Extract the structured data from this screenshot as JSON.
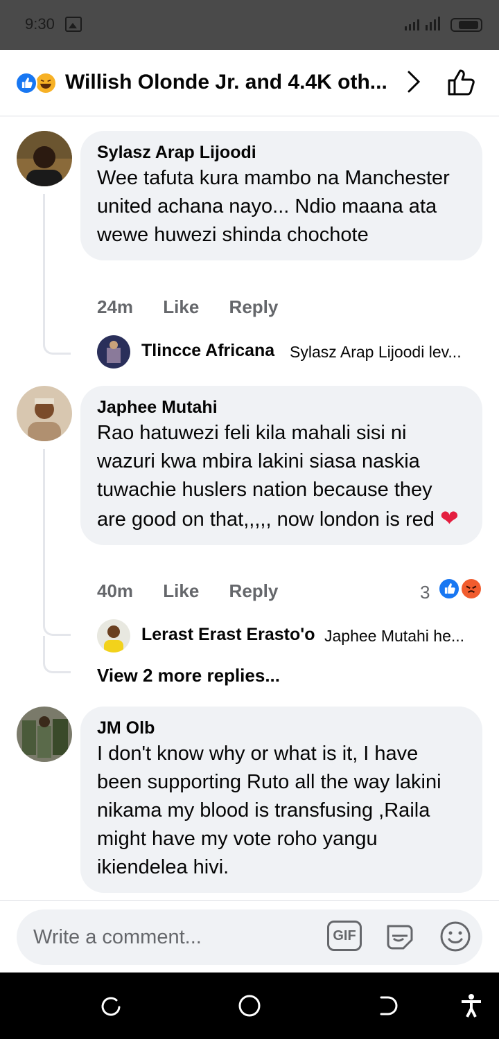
{
  "status_bar": {
    "time": "9:30"
  },
  "header": {
    "title": "Willish Olonde Jr. and 4.4K oth..."
  },
  "comments": [
    {
      "author": "Sylasz Arap Lijoodi",
      "text": "Wee tafuta kura mambo na Manchester united achana nayo... Ndio maana ata wewe huwezi shinda chochote",
      "time": "24m",
      "like_label": "Like",
      "reply_label": "Reply",
      "reply_preview": {
        "author": "Tlincce Africana",
        "snippet": "Sylasz Arap Lijoodi lev..."
      }
    },
    {
      "author": "Japhee Mutahi",
      "text": "Rao hatuwezi feli kila mahali sisi ni wazuri kwa mbira lakini siasa naskia tuwachie huslers nation because they are good on that,,,,, now london is red",
      "emoji": "❤",
      "time": "40m",
      "like_label": "Like",
      "reply_label": "Reply",
      "reaction_count": "3",
      "reactions": [
        "like-reaction",
        "angry-reaction"
      ],
      "reply_preview": {
        "author": "Lerast Erast Erasto'o",
        "snippet": "Japhee Mutahi he..."
      },
      "view_more": "View 2 more replies..."
    },
    {
      "author": "JM Olb",
      "text": "I don't know why or what is it, I have been supporting Ruto all the way lakini nikama my blood is transfusing ,Raila might have my vote roho yangu ikiendelea hivi."
    }
  ],
  "compose": {
    "placeholder": "Write a comment...",
    "gif_label": "GIF"
  },
  "icons": {
    "brand_blue": "#1877f2",
    "muted_gray": "#65676b",
    "bubble_gray": "#f0f2f5"
  }
}
